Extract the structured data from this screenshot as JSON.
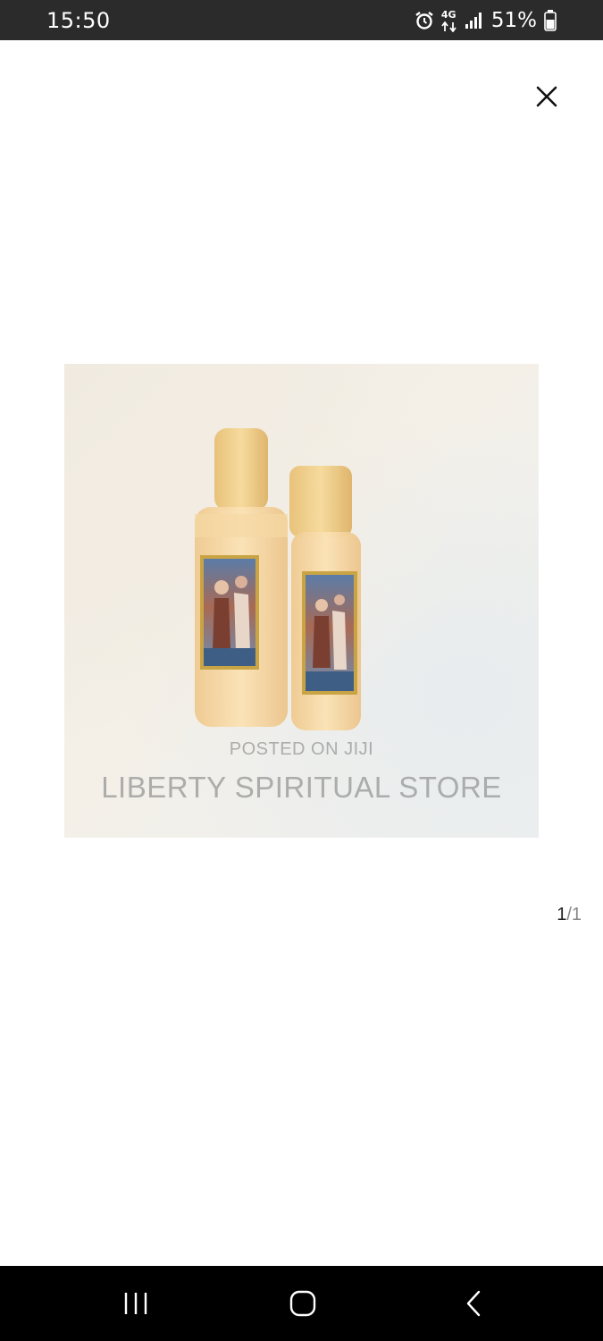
{
  "status_bar": {
    "time": "15:50",
    "network": "4G",
    "battery": "51%"
  },
  "viewer": {
    "watermark_small": "POSTED ON JIJI",
    "watermark_large": "LIBERTY SPIRITUAL STORE",
    "counter_current": "1",
    "counter_separator": "/",
    "counter_total": "1"
  },
  "icons": {
    "alarm": "alarm-icon",
    "data": "4g-data-icon",
    "signal": "signal-icon",
    "battery": "battery-icon",
    "close": "close-icon",
    "recents": "recents-icon",
    "home": "home-icon",
    "back": "back-icon"
  },
  "colors": {
    "status_bar_bg": "#2b2b2b",
    "nav_bar_bg": "#000000",
    "background": "#ffffff"
  }
}
